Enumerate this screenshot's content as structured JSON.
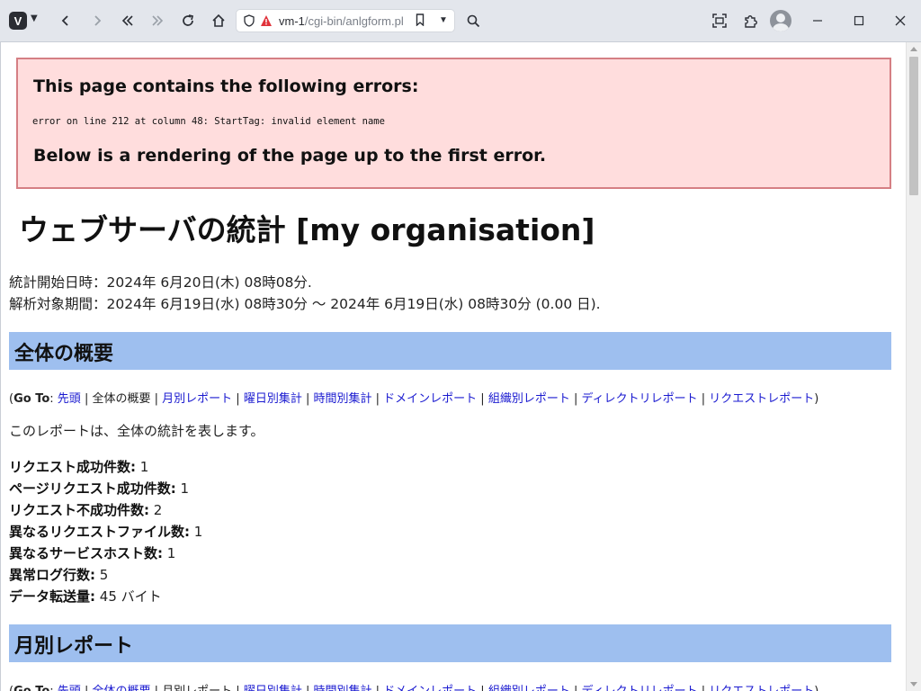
{
  "browser": {
    "url_host": "vm-1",
    "url_path": "/cgi-bin/anlgform.pl"
  },
  "error": {
    "heading": "This page contains the following errors:",
    "message": "error on line 212 at column 48: StartTag: invalid element name",
    "footer": "Below is a rendering of the page up to the first error."
  },
  "page": {
    "title": "ウェブサーバの統計 [my organisation]",
    "start_line": "統計開始日時：2024年 6月20日(木) 08時08分.",
    "period_line": "解析対象期間：2024年 6月19日(水) 08時30分 〜 2024年 6月19日(水) 08時30分 (0.00 日).",
    "description": "このレポートは、全体の統計を表します。"
  },
  "sections": {
    "overview": "全体の概要",
    "monthly": "月別レポート"
  },
  "goto": {
    "label": "Go To",
    "top": "先頭",
    "overview": "全体の概要",
    "monthly": "月別レポート",
    "weekday": "曜日別集計",
    "hourly": "時間別集計",
    "domain": "ドメインレポート",
    "org": "組織別レポート",
    "directory": "ディレクトリレポート",
    "request": "リクエストレポート"
  },
  "stats": [
    {
      "label": "リクエスト成功件数:",
      "value": "1"
    },
    {
      "label": "ページリクエスト成功件数:",
      "value": "1"
    },
    {
      "label": "リクエスト不成功件数:",
      "value": "2"
    },
    {
      "label": "異なるリクエストファイル数:",
      "value": "1"
    },
    {
      "label": "異なるサービスホスト数:",
      "value": "1"
    },
    {
      "label": "異常ログ行数:",
      "value": "5"
    },
    {
      "label": "データ転送量:",
      "value": "45 バイト"
    }
  ],
  "colors": {
    "section_bg": "#9ebfef",
    "error_bg": "#ffdddd",
    "error_border": "#d57f84",
    "link": "#1a1ad0"
  }
}
